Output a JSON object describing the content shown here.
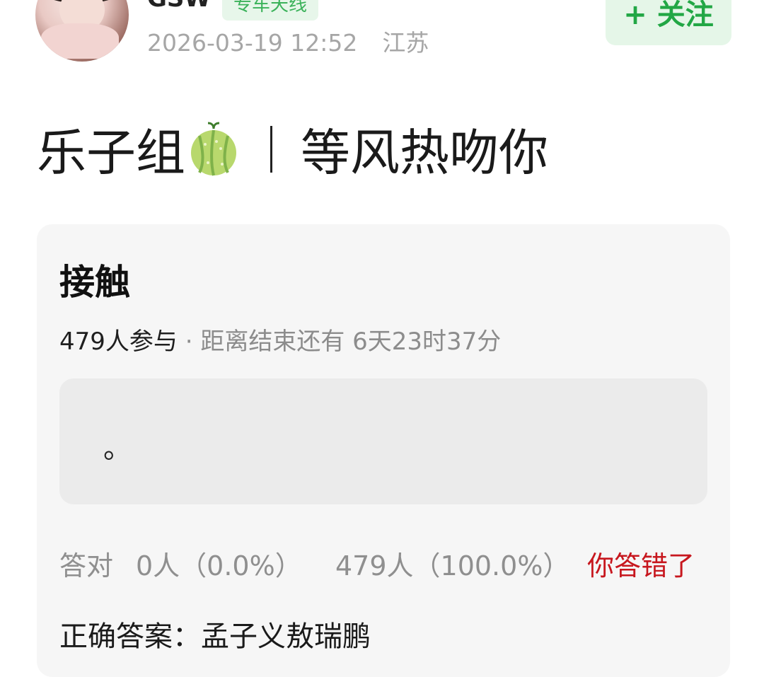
{
  "header": {
    "username": "GSW",
    "badge": "专车天线",
    "timestamp": "2026-03-19 12:52",
    "location": "江苏",
    "follow_label": "+ 关注"
  },
  "post": {
    "title_left": "乐子组",
    "title_icon": "melon-icon",
    "title_right": "等风热吻你"
  },
  "quiz": {
    "title": "接触",
    "participants": "479人参与",
    "separator": " · ",
    "deadline_label": "距离结束还有 6天23时37分",
    "answer_text": "。",
    "correct_label": "答对",
    "correct_count": "0人（0.0%）",
    "wrong_count": "479人（100.0%）",
    "result_status": "你答错了",
    "answer_key": "正确答案：孟子义敖瑞鹏"
  },
  "colors": {
    "accent_green": "#22a745",
    "error_red": "#c7171e"
  }
}
